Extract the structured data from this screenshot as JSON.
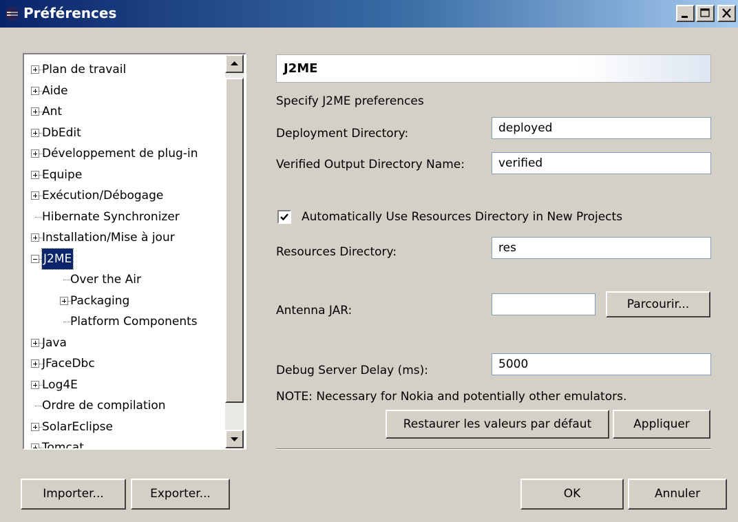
{
  "window": {
    "title": "Préférences"
  },
  "tree": {
    "items": [
      {
        "label": "Plan de travail",
        "expander": "plus",
        "level": 0,
        "selected": false
      },
      {
        "label": "Aide",
        "expander": "plus",
        "level": 0,
        "selected": false
      },
      {
        "label": "Ant",
        "expander": "plus",
        "level": 0,
        "selected": false
      },
      {
        "label": "DbEdit",
        "expander": "plus",
        "level": 0,
        "selected": false
      },
      {
        "label": "Développement de plug-in",
        "expander": "plus",
        "level": 0,
        "selected": false
      },
      {
        "label": "Equipe",
        "expander": "plus",
        "level": 0,
        "selected": false
      },
      {
        "label": "Exécution/Débogage",
        "expander": "plus",
        "level": 0,
        "selected": false
      },
      {
        "label": "Hibernate Synchronizer",
        "expander": "none",
        "level": 0,
        "selected": false
      },
      {
        "label": "Installation/Mise à jour",
        "expander": "plus",
        "level": 0,
        "selected": false
      },
      {
        "label": "J2ME",
        "expander": "minus",
        "level": 0,
        "selected": true
      },
      {
        "label": "Over the Air",
        "expander": "none",
        "level": 1,
        "selected": false
      },
      {
        "label": "Packaging",
        "expander": "plus",
        "level": 1,
        "selected": false
      },
      {
        "label": "Platform Components",
        "expander": "none",
        "level": 1,
        "selected": false
      },
      {
        "label": "Java",
        "expander": "plus",
        "level": 0,
        "selected": false
      },
      {
        "label": "JFaceDbc",
        "expander": "plus",
        "level": 0,
        "selected": false
      },
      {
        "label": "Log4E",
        "expander": "plus",
        "level": 0,
        "selected": false
      },
      {
        "label": "Ordre de compilation",
        "expander": "none",
        "level": 0,
        "selected": false
      },
      {
        "label": "SolarEclipse",
        "expander": "plus",
        "level": 0,
        "selected": false
      },
      {
        "label": "Tomcat",
        "expander": "plus",
        "level": 0,
        "selected": false
      }
    ]
  },
  "page": {
    "title": "J2ME",
    "description": "Specify J2ME preferences",
    "deployment_label": "Deployment Directory:",
    "deployment_value": "deployed",
    "verified_label": "Verified Output Directory Name:",
    "verified_value": "verified",
    "auto_resources_label": "Automatically Use Resources Directory in New Projects",
    "auto_resources_checked": true,
    "resources_label": "Resources Directory:",
    "resources_value": "res",
    "antenna_label": "Antenna JAR:",
    "antenna_value": "",
    "browse_label": "Parcourir...",
    "debug_label": "Debug Server Delay (ms):",
    "debug_value": "5000",
    "note": "NOTE: Necessary for Nokia and potentially other emulators.",
    "restore_label": "Restaurer les valeurs par défaut",
    "apply_label": "Appliquer"
  },
  "footer": {
    "import_label": "Importer...",
    "export_label": "Exporter...",
    "ok_label": "OK",
    "cancel_label": "Annuler"
  },
  "colors": {
    "titlebar_start": "#0a246a",
    "titlebar_end": "#a6caf0",
    "dialog_bg": "#d4d0c8",
    "selection": "#0a246a"
  },
  "icons": {
    "app": "eclipse-icon",
    "minimize": "minimize-icon",
    "maximize": "maximize-icon",
    "close": "close-icon",
    "scroll_up": "arrow-up-icon",
    "scroll_down": "arrow-down-icon",
    "check": "checkmark-icon"
  }
}
